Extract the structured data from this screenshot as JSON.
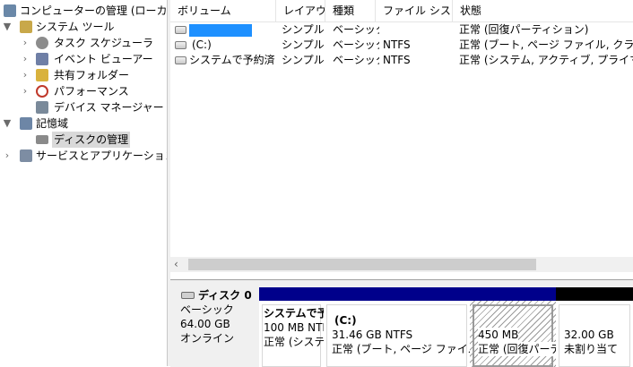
{
  "tree": {
    "items": [
      {
        "label": "コンピューターの管理 (ローカル)",
        "caret": "",
        "icon": "computer-management-icon",
        "color": "#6a88a8"
      },
      {
        "label": "システム ツール",
        "caret": "▼",
        "icon": "tools-icon",
        "color": "#c8a84a"
      },
      {
        "label": "タスク スケジューラ",
        "caret": "›",
        "icon": "clock-icon",
        "color": "#8c8c8c"
      },
      {
        "label": "イベント ビューアー",
        "caret": "›",
        "icon": "event-viewer-icon",
        "color": "#6f7fa6"
      },
      {
        "label": "共有フォルダー",
        "caret": "›",
        "icon": "shared-folder-icon",
        "color": "#d9b23d"
      },
      {
        "label": "パフォーマンス",
        "caret": "›",
        "icon": "performance-icon",
        "color": "#c0392b"
      },
      {
        "label": "デバイス マネージャー",
        "caret": "",
        "icon": "device-manager-icon",
        "color": "#7a8a9a"
      },
      {
        "label": "記憶域",
        "caret": "▼",
        "icon": "storage-icon",
        "color": "#6d86a6"
      },
      {
        "label": "ディスクの管理",
        "caret": "",
        "icon": "disk-management-icon",
        "color": "#8a8a8a"
      },
      {
        "label": "サービスとアプリケーション",
        "caret": "›",
        "icon": "services-icon",
        "color": "#7d8da3"
      }
    ]
  },
  "volumes": {
    "columns": [
      "ボリューム",
      "レイアウト",
      "種類",
      "ファイル システム",
      "状態"
    ],
    "rows": [
      {
        "name": "",
        "layout": "シンプル",
        "type": "ベーシック",
        "fs": "",
        "status": "正常 (回復パーティション)"
      },
      {
        "name": "(C:)",
        "layout": "シンプル",
        "type": "ベーシック",
        "fs": "NTFS",
        "status": "正常 (ブート, ページ ファイル, クラッシュ ダンプ, ベーシック データ パーティション)"
      },
      {
        "name": "システムで予約済み",
        "layout": "シンプル",
        "type": "ベーシック",
        "fs": "NTFS",
        "status": "正常 (システム, アクティブ, プライマリ パーティション)"
      }
    ]
  },
  "disk": {
    "name": "ディスク 0",
    "kind": "ベーシック",
    "size": "64.00 GB",
    "state": "オンライン",
    "partitions": [
      {
        "title": "システムで予約済み",
        "size": "100 MB NTFS",
        "status": "正常 (システム, アクティブ, プライマリ パーティション)",
        "bar": "#00008b"
      },
      {
        "title": "(C:)",
        "size": "31.46 GB NTFS",
        "status": "正常 (ブート, ページ ファイル, クラッシュ ダンプ)",
        "bar": "#00008b"
      },
      {
        "title": "",
        "size": "450 MB",
        "status": "正常 (回復パーティション)",
        "bar": "#00008b"
      },
      {
        "title": "",
        "size": "32.00 GB",
        "status": "未割り当て",
        "bar": "#000000"
      }
    ]
  }
}
